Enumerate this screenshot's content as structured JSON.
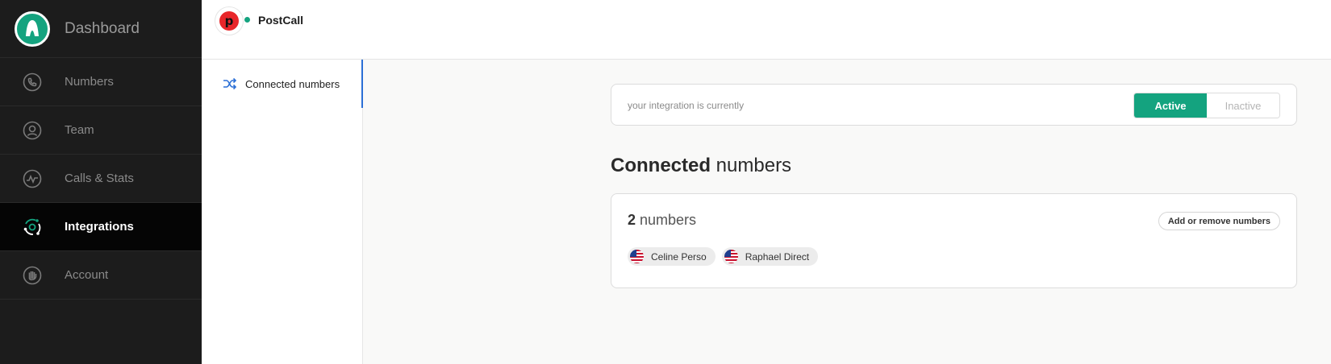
{
  "sidebar": {
    "brand": {
      "label": "Dashboard"
    },
    "items": [
      {
        "label": "Numbers",
        "icon": "phone-icon"
      },
      {
        "label": "Team",
        "icon": "user-circle-icon"
      },
      {
        "label": "Calls & Stats",
        "icon": "activity-icon"
      },
      {
        "label": "Integrations",
        "icon": "integrations-icon",
        "active": true
      },
      {
        "label": "Account",
        "icon": "hand-icon"
      }
    ]
  },
  "header": {
    "app_name": "PostCall",
    "app_logo_letter": "p"
  },
  "subnav": {
    "items": [
      {
        "label": "Connected numbers",
        "icon": "shuffle-icon",
        "active": true
      }
    ]
  },
  "main": {
    "status_text": "your integration is currently",
    "toggle": {
      "active_label": "Active",
      "inactive_label": "Inactive",
      "selected": "Active"
    },
    "section_title_bold": "Connected",
    "section_title_rest": " numbers",
    "numbers_card": {
      "count": "2",
      "count_label": " numbers",
      "add_button": "Add or remove numbers",
      "numbers": [
        {
          "name": "Celine Perso",
          "flag": "us-flag-icon"
        },
        {
          "name": "Raphael Direct",
          "flag": "us-flag-icon"
        }
      ]
    }
  },
  "colors": {
    "accent": "#14a37f",
    "sidebar_bg": "#1c1c1c",
    "subnav_active": "#2b6fd6",
    "postcall_red": "#e8262a"
  }
}
